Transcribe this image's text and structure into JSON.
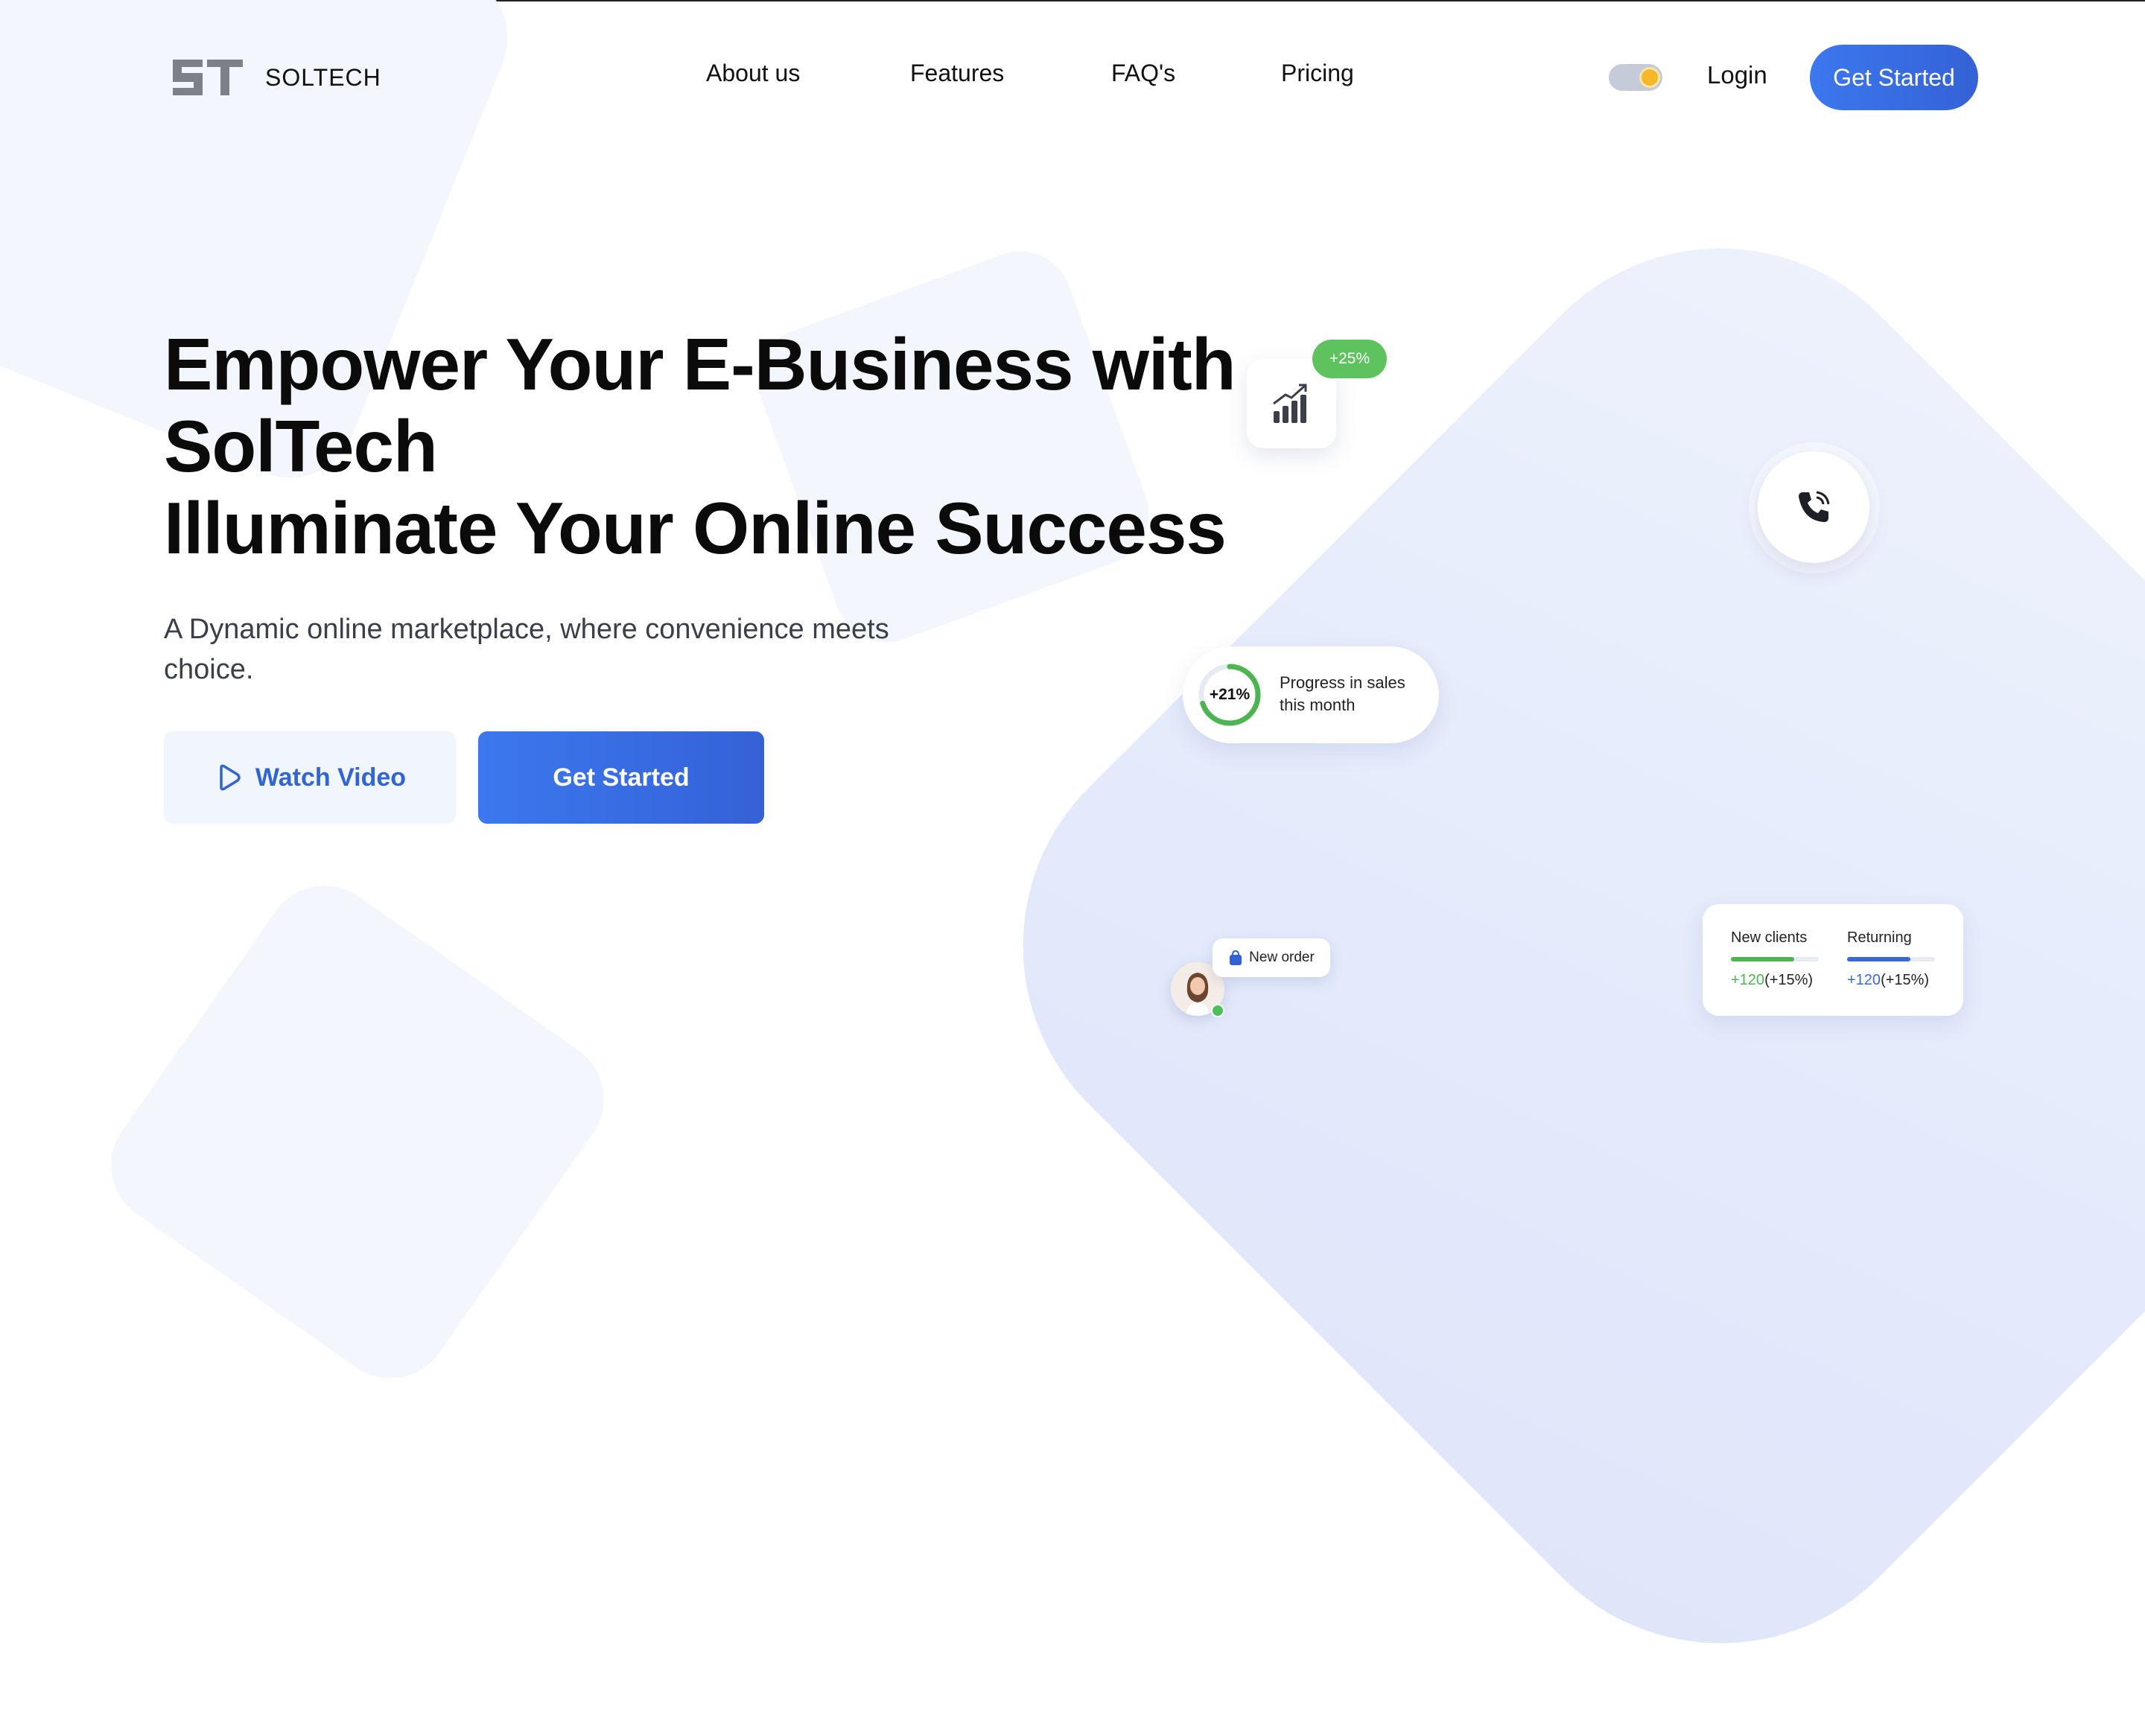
{
  "header": {
    "brand": "SOLTECH",
    "nav": [
      {
        "label": "About us"
      },
      {
        "label": "Features"
      },
      {
        "label": "FAQ's"
      },
      {
        "label": "Pricing"
      }
    ],
    "login_label": "Login",
    "cta_label": "Get Started",
    "theme_toggle": {
      "state": "light",
      "icon": "sun-icon"
    }
  },
  "hero": {
    "title_lines": [
      "Empower Your E-Business with",
      "SolTech",
      "Illuminate Your Online Success"
    ],
    "subtitle": "A Dynamic online marketplace, where convenience meets choice.",
    "watch_label": "Watch Video",
    "cta_label": "Get Started"
  },
  "widgets": {
    "growth_badge": "+25%",
    "progress": {
      "value_label": "+21%",
      "fraction": 0.7,
      "text": "Progress in sales this month"
    },
    "new_order_label": "New order",
    "clients": {
      "new": {
        "title": "New clients",
        "change": "+120",
        "percent": "(+15%)",
        "fraction": 0.72
      },
      "returning": {
        "title": "Returning",
        "change": "+120",
        "percent": "(+15%)",
        "fraction": 0.72
      }
    }
  },
  "colors": {
    "accent": "#3c78ee",
    "accent_dark": "#3561d6",
    "green": "#5ec25e",
    "text": "#0b0b0b"
  }
}
